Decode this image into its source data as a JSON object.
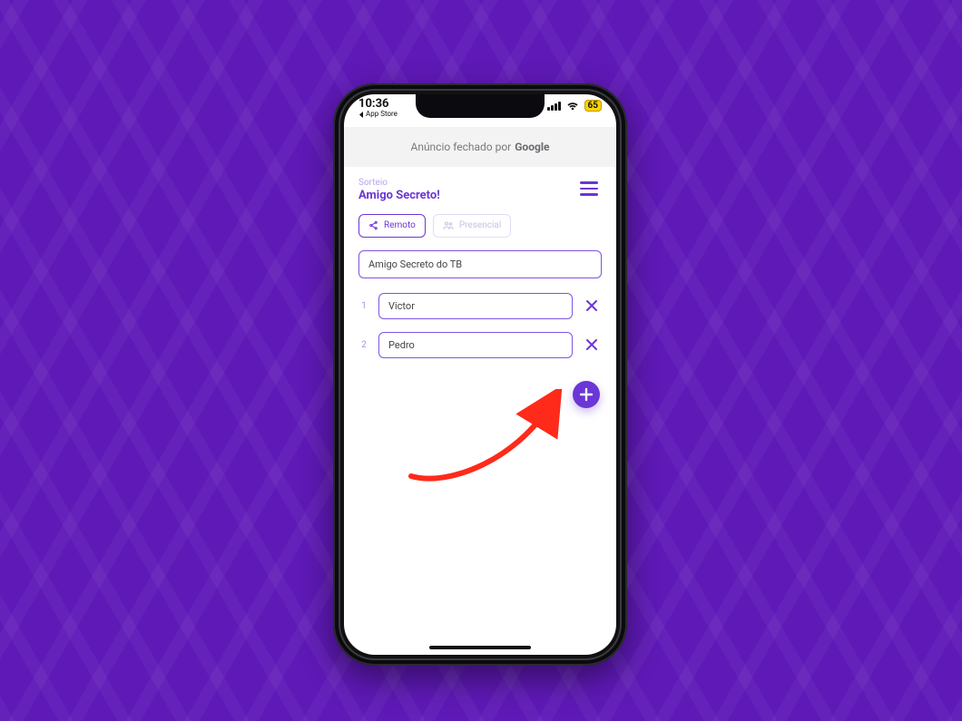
{
  "statusbar": {
    "time": "10:36",
    "back_label": "App Store",
    "battery": "65"
  },
  "adbar": {
    "prefix": "Anúncio fechado por",
    "brand": "Google"
  },
  "header": {
    "kicker": "Sorteio",
    "title": "Amigo Secreto!"
  },
  "modes": {
    "remote": "Remoto",
    "presencial": "Presencial"
  },
  "group_name": "Amigo Secreto do TB",
  "participants": [
    {
      "idx": "1",
      "name": "Victor"
    },
    {
      "idx": "2",
      "name": "Pedro"
    }
  ],
  "icons": {
    "menu": "menu-icon",
    "share": "share-icon",
    "people": "people-icon",
    "close": "close-icon",
    "plus": "plus-icon"
  },
  "colors": {
    "accent": "#6a36d6",
    "bg": "#5f19b7",
    "annotation": "#ff2a1a"
  }
}
